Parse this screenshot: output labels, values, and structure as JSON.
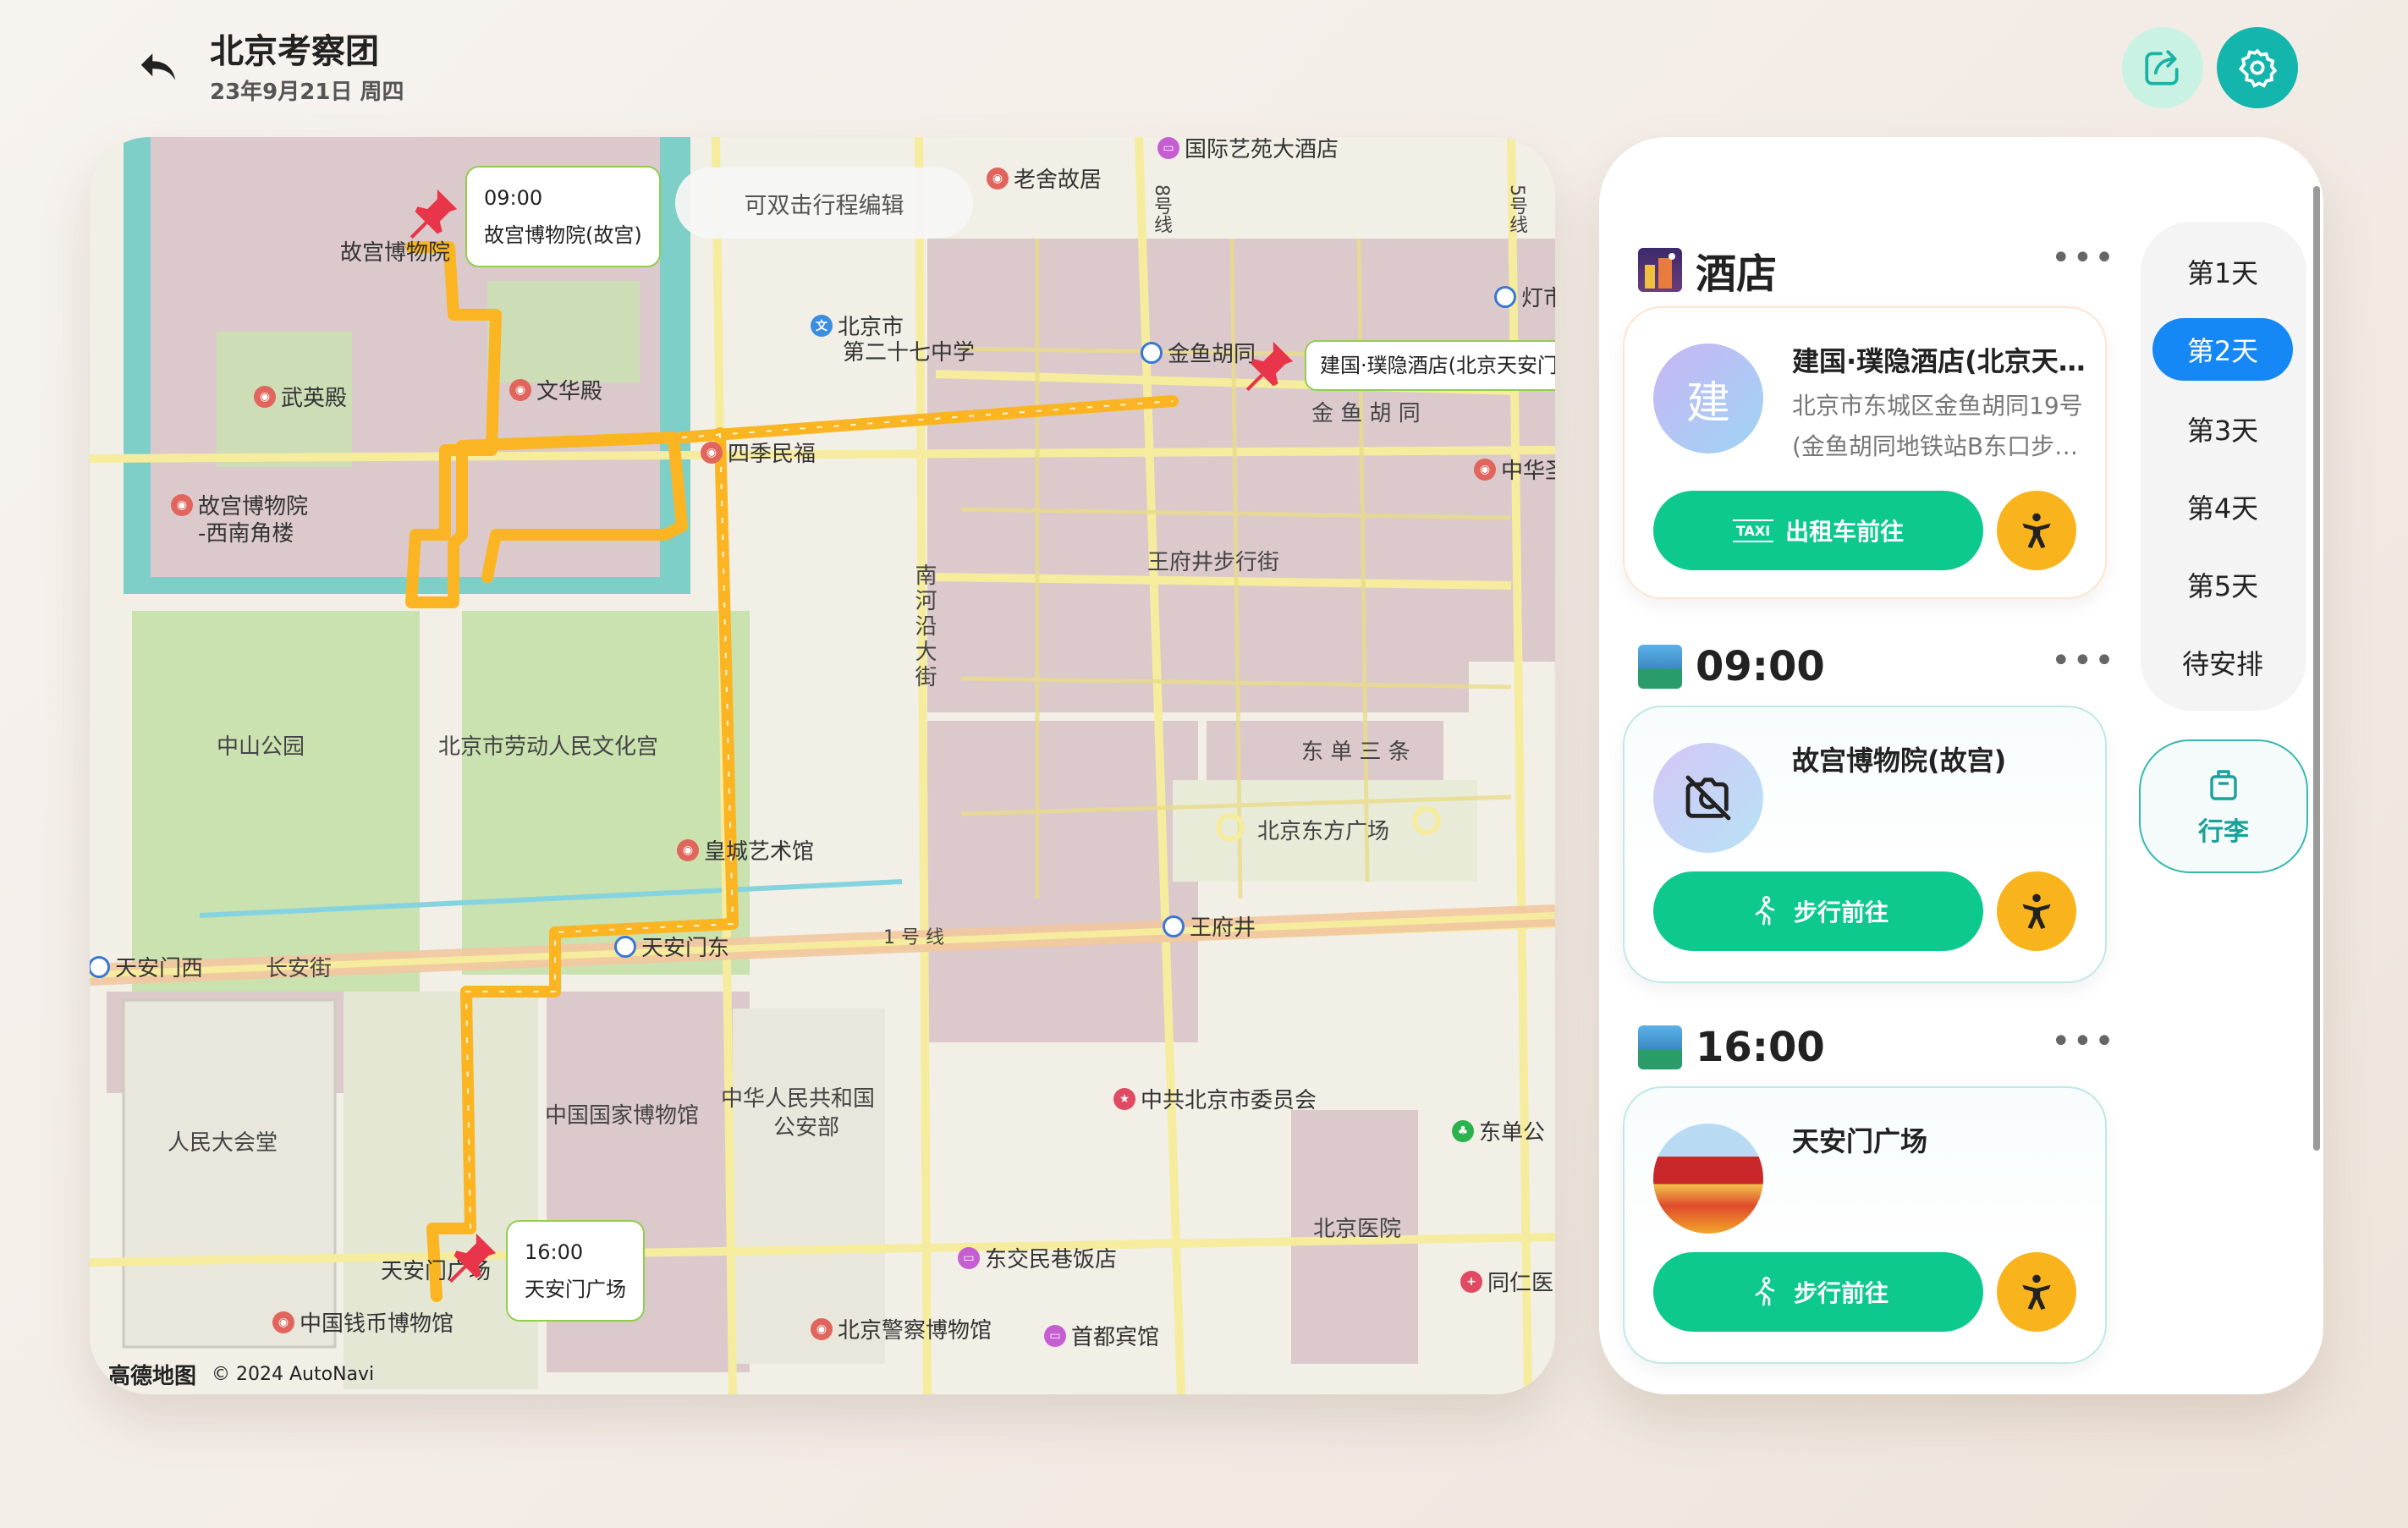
{
  "header": {
    "title": "北京考察团",
    "date": "23年9月21日 周四"
  },
  "map": {
    "hint": "可双击行程编辑",
    "callouts": [
      {
        "time": "09:00",
        "place": "故宫博物院(故宫)"
      },
      {
        "place": "建国·璞隐酒店(北京天安门"
      },
      {
        "time": "16:00",
        "place": "天安门广场"
      }
    ],
    "area_labels": [
      "中山公园",
      "北京市劳动人民文化宫",
      "王府井步行街",
      "北京东方广场",
      "人民大会堂",
      "中国国家博物馆",
      "中华人民共和国",
      "公安部",
      "长安街",
      "金 鱼 胡 同",
      "东 单 三 条",
      "北京医院",
      "1 号 线"
    ],
    "vertical_labels": [
      "南河沿大街",
      "8号线",
      "5号线"
    ],
    "pois": [
      "老舍故居",
      "国际艺苑大酒店",
      "故宫博物院",
      "武英殿",
      "文华殿",
      "故宫博物院",
      "-西南角楼",
      "四季民福",
      "北京市",
      "第二十七中学",
      "金鱼胡同",
      "灯市",
      "中华圣",
      "皇城艺术馆",
      "天安门东",
      "天安门西",
      "王府井",
      "中共北京市委员会",
      "东单公",
      "同仁医",
      "东交民巷饭店",
      "北京警察博物馆",
      "首都宾馆",
      "中国钱币博物馆",
      "天安门广场"
    ],
    "credit_brand": "高德地图",
    "credit_text": "© 2024 AutoNavi"
  },
  "panel": {
    "hotel_section": {
      "title": "酒店",
      "more": "•••"
    },
    "hotel_card": {
      "avatar": "建",
      "name": "建国·璞隐酒店(北京天…",
      "addr1": "北京市东城区金鱼胡同19号",
      "addr2": "(金鱼胡同地铁站B东口步…",
      "button": "出租车前往",
      "taxi_tag": "TAXI"
    },
    "spot1": {
      "time": "09:00",
      "more": "•••",
      "name": "故宫博物院(故宫)",
      "button": "步行前往"
    },
    "spot2": {
      "time": "16:00",
      "more": "•••",
      "name": "天安门广场",
      "button": "步行前往"
    },
    "days": [
      "第1天",
      "第2天",
      "第3天",
      "第4天",
      "第5天",
      "待安排"
    ],
    "active_day": "第2天",
    "luggage": "行李"
  },
  "colors": {
    "accent_teal": "#14b5ad",
    "go_green": "#0dc98e",
    "acc_orange": "#f9b31c",
    "day_active": "#1688f5",
    "route": "#fbb523"
  },
  "icons": [
    "back-arrow-icon",
    "share-icon",
    "gear-icon",
    "pin-icon",
    "taxi-icon",
    "walk-icon",
    "accessibility-icon",
    "no-photo-icon",
    "luggage-icon"
  ]
}
